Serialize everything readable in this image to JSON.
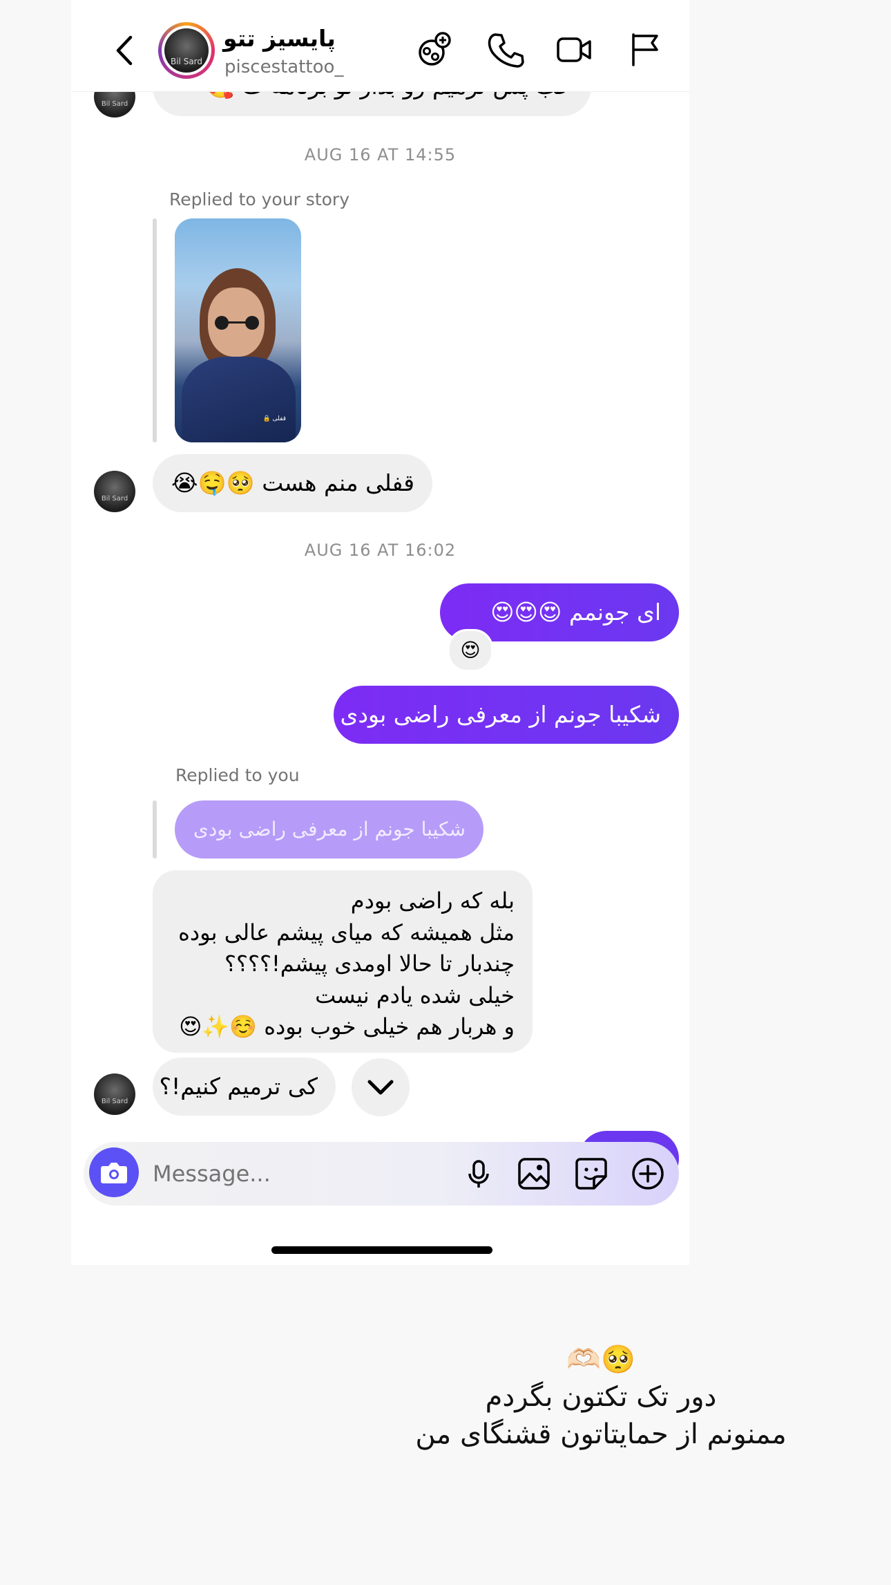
{
  "header": {
    "display_name": "پایسیز تتو",
    "username": "piscestattoo_",
    "avatar_text": "Bil Sard"
  },
  "thread": {
    "cutoff_message": "خب پس ترمیم رو بذار تو برنامه ت 🥰",
    "stamp1": "AUG 16 AT 14:55",
    "story_reply_label": "Replied to your story",
    "story_tag": "قفلی 🔒",
    "msg_qofli": "قفلی منم هست 🥺🤤😭",
    "stamp2": "AUG 16 AT 16:02",
    "out_msg1": "ای جونمم 😍😍😍",
    "reaction": "😍",
    "out_msg2": "شکیبا جونم از معرفی راضی بودی ؟",
    "replied_to_you_label": "Replied to you",
    "quoted": "شکیبا جونم از معرفی راضی بودی ؟",
    "long_msg": {
      "l1": "بله که راضی بودم",
      "l2": "مثل همیشه که میای پیشم عالی بوده",
      "l3": "چندبار تا حالا اومدی پیشم!؟؟؟؟",
      "l4": "خیلی شده یادم نیست",
      "l5": "و هربار هم خیلی خوب بوده ☺️✨😍"
    },
    "last_msg": "کی ترمیم کنیم!؟"
  },
  "composer": {
    "placeholder": "Message..."
  },
  "caption": {
    "line1": "🥺🫶🏻",
    "line2": "دور تک تکتون بگردم",
    "line3": "ممنونم از حمایتاتون قشنگای من"
  },
  "colors": {
    "accent": "#7b2ff7",
    "camera": "#5b51f5"
  },
  "icons": [
    "back-chevron-icon",
    "add-effect-icon",
    "phone-icon",
    "video-icon",
    "flag-icon",
    "camera-icon",
    "microphone-icon",
    "image-icon",
    "sticker-icon",
    "plus-circle-icon",
    "chevron-down-icon"
  ]
}
